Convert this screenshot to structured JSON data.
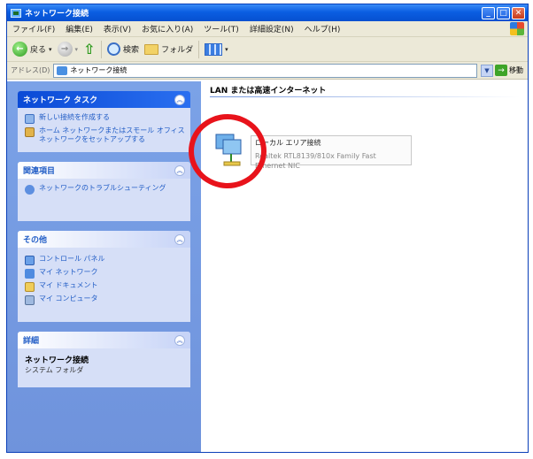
{
  "window": {
    "title": "ネットワーク接続"
  },
  "menubar": {
    "items": [
      "ファイル(F)",
      "編集(E)",
      "表示(V)",
      "お気に入り(A)",
      "ツール(T)",
      "詳細設定(N)",
      "ヘルプ(H)"
    ]
  },
  "toolbar": {
    "back_label": "戻る",
    "search_label": "検索",
    "folders_label": "フォルダ"
  },
  "address": {
    "label": "アドレス(D)",
    "value": "ネットワーク接続",
    "go_label": "移動"
  },
  "sidebar": {
    "network_tasks": {
      "title": "ネットワーク タスク",
      "items": [
        "新しい接続を作成する",
        "ホーム ネットワークまたはスモール オフィス ネットワークをセットアップする"
      ]
    },
    "see_also": {
      "title": "関連項目",
      "items": [
        "ネットワークのトラブルシューティング"
      ]
    },
    "other_places": {
      "title": "その他",
      "items": [
        "コントロール パネル",
        "マイ ネットワーク",
        "マイ ドキュメント",
        "マイ コンピュータ"
      ]
    },
    "details": {
      "title": "詳細",
      "name": "ネットワーク接続",
      "type": "システム フォルダ"
    }
  },
  "content": {
    "group_header": "LAN または高速インターネット",
    "connection": {
      "name": "ローカル エリア接続",
      "description": "Realtek RTL8139/810x Family Fast Ethernet NIC"
    }
  }
}
